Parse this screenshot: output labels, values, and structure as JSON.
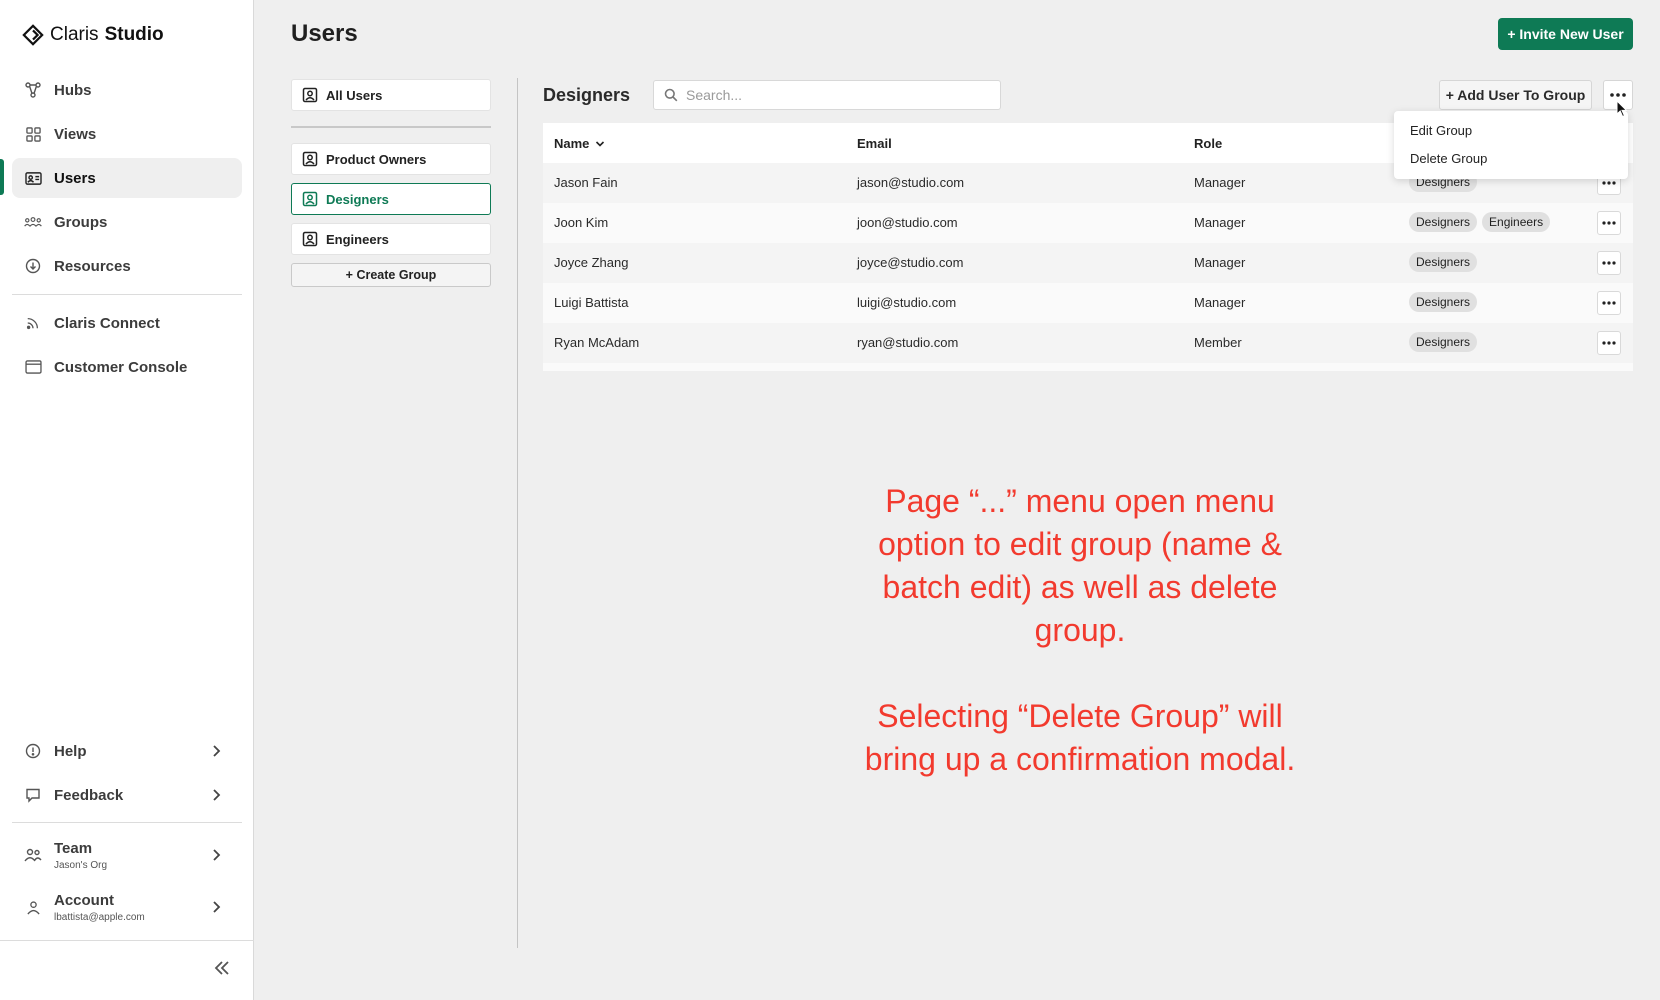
{
  "sidebar": {
    "brand": {
      "name_a": "Claris",
      "name_b": "Studio"
    },
    "nav": [
      {
        "label": "Hubs",
        "icon": "hubs-icon"
      },
      {
        "label": "Views",
        "icon": "grid-icon"
      },
      {
        "label": "Users",
        "icon": "id-card-icon",
        "active": true
      },
      {
        "label": "Groups",
        "icon": "people-group-icon"
      },
      {
        "label": "Resources",
        "icon": "download-circle-icon"
      }
    ],
    "secondary": [
      {
        "label": "Claris Connect",
        "icon": "rss-icon"
      },
      {
        "label": "Customer Console",
        "icon": "window-icon"
      }
    ],
    "bottom": [
      {
        "label": "Help",
        "icon": "info-circle-icon"
      },
      {
        "label": "Feedback",
        "icon": "speech-bubble-icon"
      }
    ],
    "team": {
      "label": "Team",
      "sub": "Jason's Org"
    },
    "account": {
      "label": "Account",
      "sub": "lbattista@apple.com"
    }
  },
  "page": {
    "title": "Users",
    "invite_label": "+ Invite New User"
  },
  "groups": {
    "all_users": "All Users",
    "items": [
      {
        "label": "Product Owners"
      },
      {
        "label": "Designers",
        "selected": true
      },
      {
        "label": "Engineers"
      }
    ],
    "create_label": "+ Create Group"
  },
  "content": {
    "section_title": "Designers",
    "search_placeholder": "Search...",
    "add_user_label": "+ Add User To Group",
    "more_label": "•••"
  },
  "table": {
    "headers": {
      "name": "Name",
      "email": "Email",
      "role": "Role"
    },
    "rows": [
      {
        "name": "Jason Fain",
        "email": "jason@studio.com",
        "role": "Manager",
        "groups": [
          "Designers"
        ]
      },
      {
        "name": "Joon Kim",
        "email": "joon@studio.com",
        "role": "Manager",
        "groups": [
          "Designers",
          "Engineers"
        ]
      },
      {
        "name": "Joyce Zhang",
        "email": "joyce@studio.com",
        "role": "Manager",
        "groups": [
          "Designers"
        ]
      },
      {
        "name": "Luigi Battista",
        "email": "luigi@studio.com",
        "role": "Manager",
        "groups": [
          "Designers"
        ]
      },
      {
        "name": "Ryan McAdam",
        "email": "ryan@studio.com",
        "role": "Member",
        "groups": [
          "Designers"
        ]
      }
    ]
  },
  "dropdown": {
    "items": [
      "Edit Group",
      "Delete Group"
    ]
  },
  "annotation": {
    "paragraph1": "Page “...” menu open menu option to edit group (name & batch edit) as well as delete group.",
    "paragraph2": "Selecting “Delete Group” will bring up a confirmation modal."
  },
  "colors": {
    "accent": "#0e7a55",
    "annotation": "#f23a2e"
  }
}
